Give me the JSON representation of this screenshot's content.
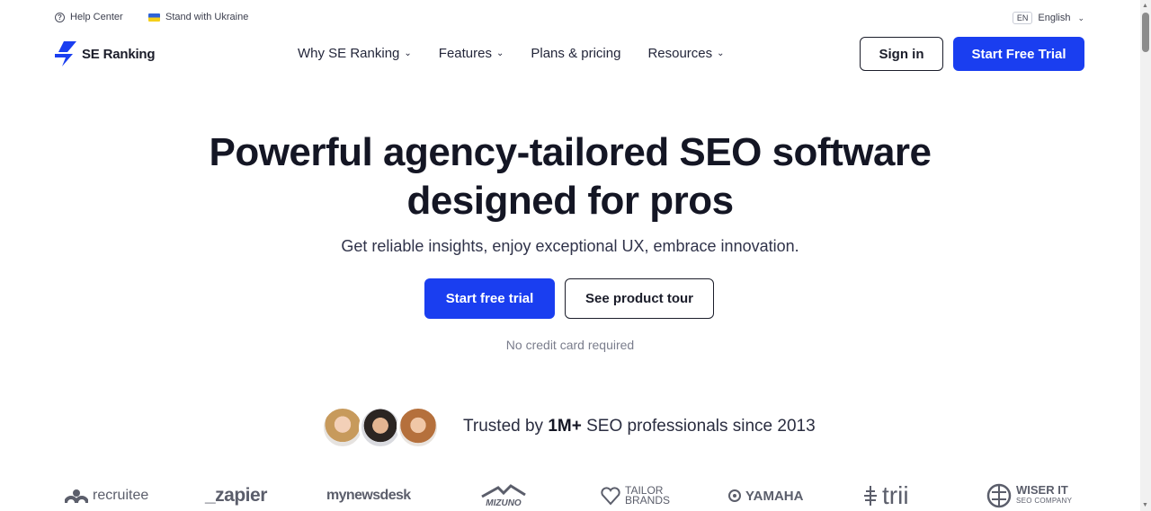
{
  "topbar": {
    "help_label": "Help Center",
    "ukraine_label": "Stand with Ukraine",
    "lang_code": "EN",
    "lang_label": "English"
  },
  "nav": {
    "logo_text": "SE Ranking",
    "items": [
      {
        "label": "Why SE Ranking",
        "has_dropdown": true
      },
      {
        "label": "Features",
        "has_dropdown": true
      },
      {
        "label": "Plans & pricing",
        "has_dropdown": false
      },
      {
        "label": "Resources",
        "has_dropdown": true
      }
    ],
    "signin_label": "Sign in",
    "trial_label": "Start Free Trial"
  },
  "hero": {
    "title_line1": "Powerful agency-tailored SEO software",
    "title_line2": "designed for pros",
    "subtitle": "Get reliable insights, enjoy exceptional UX, embrace innovation.",
    "cta_primary": "Start free trial",
    "cta_secondary": "See product tour",
    "note": "No credit card required"
  },
  "trust": {
    "prefix": "Trusted by ",
    "highlight": "1M+",
    "suffix": " SEO professionals since 2013"
  },
  "client_logos": {
    "recruitee": "recruitee",
    "zapier": "_zapier",
    "mynewsdesk": "mynewsdesk",
    "mizuno": "MIZUNO",
    "tailor_line1": "TAILOR",
    "tailor_line2": "BRANDS",
    "yamaha": "YAMAHA",
    "trii": "trii",
    "wiser_line1": "WISER IT",
    "wiser_line2": "SEO COMPANY"
  },
  "colors": {
    "accent": "#1a3ef0",
    "text_dark": "#141624",
    "muted": "#7a7d8c"
  }
}
